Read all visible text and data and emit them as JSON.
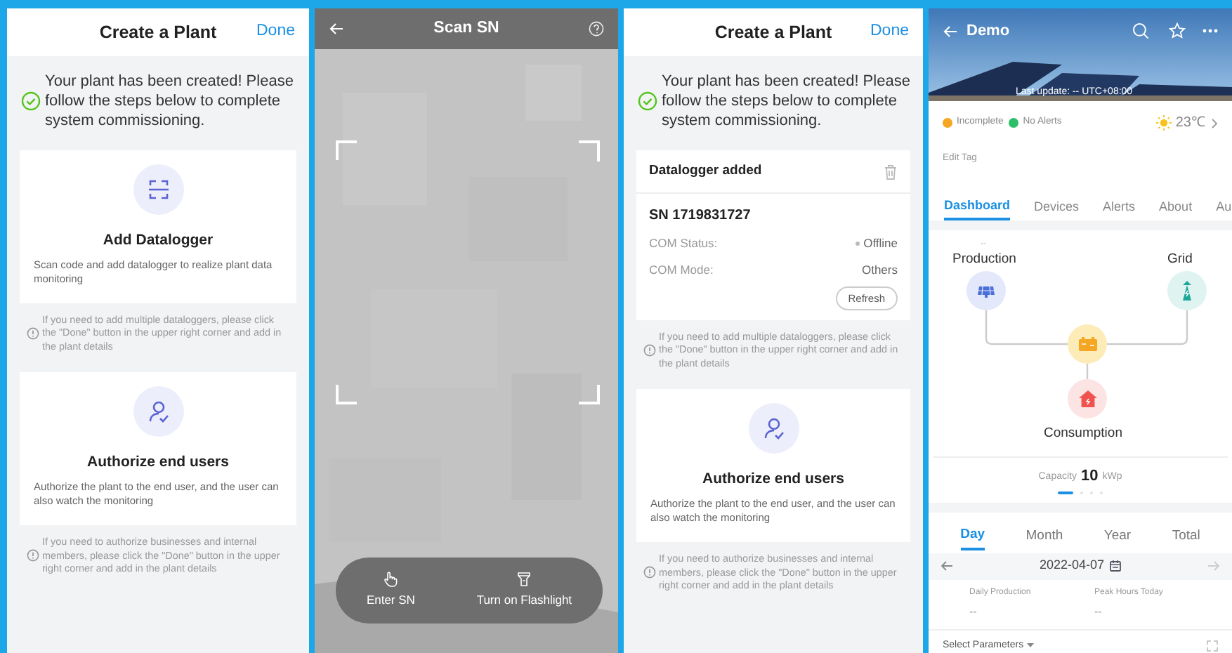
{
  "screens": [
    {
      "kind": "create_plant",
      "title": "Create a Plant",
      "done_button": "Done",
      "message": "Your plant has been created! Please follow the steps below to complete system commissioning.",
      "steps": [
        {
          "kind": "datalogger",
          "title": "Add Datalogger",
          "description": "Scan code and add datalogger to realize plant data monitoring",
          "note": "If you need to add multiple dataloggers, please click the \"Done\" button in the upper right corner and add in the plant details"
        },
        {
          "kind": "authorize",
          "title": "Authorize end users",
          "description": "Authorize the plant to the end user, and the user can also watch the monitoring",
          "note": "If you need to authorize businesses and internal members, please click the \"Done\" button in the upper right corner and add in the plant details"
        }
      ]
    },
    {
      "kind": "scan",
      "title": "Scan SN",
      "actions": [
        {
          "kind": "hand",
          "label": "Enter SN"
        },
        {
          "kind": "flashlight",
          "label": "Turn on Flashlight"
        }
      ]
    },
    {
      "kind": "create_plant",
      "title": "Create a Plant",
      "done_button": "Done",
      "message": "Your plant has been created! Please follow the steps below to complete system commissioning.",
      "steps": [
        {
          "kind": "added",
          "title": "Datalogger added",
          "sn": "SN 1719831727",
          "fields": [
            {
              "kind": "status",
              "label": "COM Status:",
              "value": "Offline"
            },
            {
              "kind": "text",
              "label": "COM Mode:",
              "value": "Others"
            }
          ],
          "refresh_button": "Refresh",
          "note": "If you need to add multiple dataloggers, please click the \"Done\" button in the upper right corner and add in the plant details"
        },
        {
          "kind": "authorize",
          "title": "Authorize end users",
          "description": "Authorize the plant to the end user, and the user can also watch the monitoring",
          "note": "If you need to authorize businesses and internal members, please click the \"Done\" button in the upper right corner and add in the plant details"
        }
      ]
    },
    {
      "kind": "plant",
      "title": "Demo",
      "last_update": "Last update: -- UTC+08:00",
      "statuses": [
        {
          "label": "Incomplete",
          "color": "#f5a623"
        },
        {
          "label": "No Alerts",
          "color": "#2dbf68"
        }
      ],
      "temperature": "23℃",
      "edit_tag": "Edit Tag",
      "tabs": [
        {
          "label": "Dashboard",
          "selected": true
        },
        {
          "label": "Devices",
          "selected": false
        },
        {
          "label": "Alerts",
          "selected": false
        },
        {
          "label": "About",
          "selected": false
        },
        {
          "label": "Au",
          "selected": false
        }
      ],
      "flow": {
        "production_value": "--",
        "production": "Production",
        "grid": "Grid",
        "consumption": "Consumption"
      },
      "capacity": {
        "label": "Capacity",
        "value": "10",
        "unit": "kWp"
      },
      "pager": [
        {
          "selected": true
        },
        {
          "selected": false
        },
        {
          "selected": false
        },
        {
          "selected": false
        }
      ],
      "periods": [
        {
          "label": "Day",
          "selected": true
        },
        {
          "label": "Month",
          "selected": false
        },
        {
          "label": "Year",
          "selected": false
        },
        {
          "label": "Total",
          "selected": false
        }
      ],
      "date": "2022-04-07",
      "stats": [
        {
          "label": "Daily Production",
          "value": "--"
        },
        {
          "label": "Peak Hours Today",
          "value": "--"
        }
      ],
      "select_parameters": "Select Parameters"
    }
  ]
}
